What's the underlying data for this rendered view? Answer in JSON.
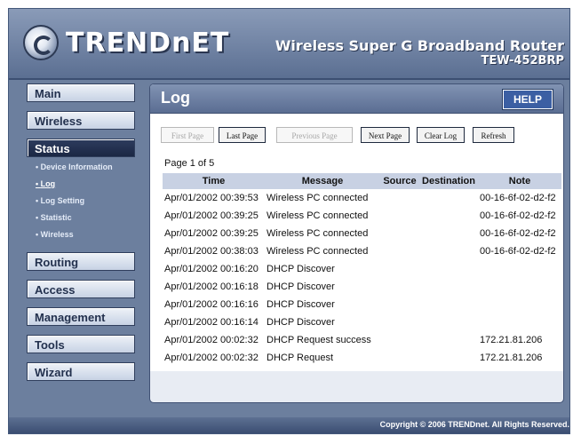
{
  "header": {
    "brand": "TRENDnET",
    "product_name": "Wireless Super G Broadband Router",
    "product_model": "TEW-452BRP"
  },
  "sidebar": {
    "items": [
      {
        "label": "Main"
      },
      {
        "label": "Wireless"
      },
      {
        "label": "Status",
        "subitems": [
          "Device Information",
          "Log",
          "Log Setting",
          "Statistic",
          "Wireless"
        ]
      },
      {
        "label": "Routing"
      },
      {
        "label": "Access"
      },
      {
        "label": "Management"
      },
      {
        "label": "Tools"
      },
      {
        "label": "Wizard"
      }
    ]
  },
  "panel": {
    "title": "Log",
    "help_label": "HELP",
    "toolbar": {
      "first_page": "First Page",
      "last_page": "Last Page",
      "previous_page": "Previous Page",
      "next_page": "Next Page",
      "clear_log": "Clear Log",
      "refresh": "Refresh"
    },
    "page_indicator": "Page 1 of 5",
    "table": {
      "headers": [
        "Time",
        "Message",
        "Source",
        "Destination",
        "Note"
      ],
      "rows": [
        {
          "time": "Apr/01/2002 00:39:53",
          "message": "Wireless PC connected",
          "source": "",
          "destination": "",
          "note": "00-16-6f-02-d2-f2"
        },
        {
          "time": "Apr/01/2002 00:39:25",
          "message": "Wireless PC connected",
          "source": "",
          "destination": "",
          "note": "00-16-6f-02-d2-f2"
        },
        {
          "time": "Apr/01/2002 00:39:25",
          "message": "Wireless PC connected",
          "source": "",
          "destination": "",
          "note": "00-16-6f-02-d2-f2"
        },
        {
          "time": "Apr/01/2002 00:38:03",
          "message": "Wireless PC connected",
          "source": "",
          "destination": "",
          "note": "00-16-6f-02-d2-f2"
        },
        {
          "time": "Apr/01/2002 00:16:20",
          "message": "DHCP Discover",
          "source": "",
          "destination": "",
          "note": ""
        },
        {
          "time": "Apr/01/2002 00:16:18",
          "message": "DHCP Discover",
          "source": "",
          "destination": "",
          "note": ""
        },
        {
          "time": "Apr/01/2002 00:16:16",
          "message": "DHCP Discover",
          "source": "",
          "destination": "",
          "note": ""
        },
        {
          "time": "Apr/01/2002 00:16:14",
          "message": "DHCP Discover",
          "source": "",
          "destination": "",
          "note": ""
        },
        {
          "time": "Apr/01/2002 00:02:32",
          "message": "DHCP Request success",
          "source": "",
          "destination": "",
          "note": "172.21.81.206"
        },
        {
          "time": "Apr/01/2002 00:02:32",
          "message": "DHCP Request",
          "source": "",
          "destination": "",
          "note": "172.21.81.206"
        }
      ]
    }
  },
  "footer": {
    "copyright": "Copyright © 2006 TRENDnet. All Rights Reserved."
  },
  "colors": {
    "frame": "#6c7f9e",
    "panel_header": "#5a6d92",
    "table_header": "#c8d1e3",
    "help_button": "#3c5fa3",
    "active_nav": "#1b2744"
  },
  "icons": {
    "logo": "trendnet-logo-icon"
  }
}
